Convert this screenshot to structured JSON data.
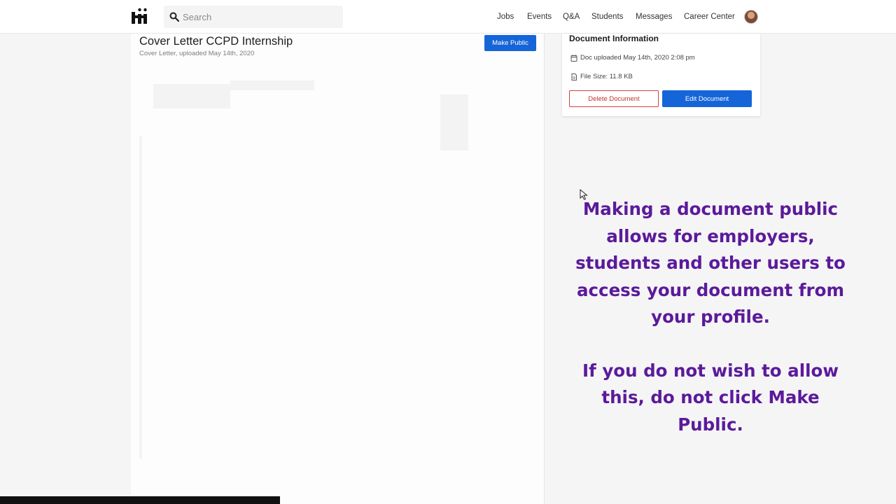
{
  "topbar": {
    "search_placeholder": "Search",
    "nav": [
      "Jobs",
      "Events",
      "Q&A",
      "Students",
      "Messages",
      "Career Center"
    ]
  },
  "document": {
    "title": "Cover Letter CCPD Internship",
    "subtitle": "Cover Letter, uploaded May 14th, 2020",
    "make_public_label": "Make Public"
  },
  "info": {
    "heading": "Document Information",
    "uploaded": "Doc uploaded May 14th, 2020 2:08 pm",
    "file_size": "File Size: 11.8 KB",
    "delete_label": "Delete Document",
    "edit_label": "Edit Document"
  },
  "overlay": {
    "paragraph1": "Making a document public allows for employers, students and other users to access your document from your profile.",
    "paragraph2": "If you do not wish to allow this, do not click Make Public."
  },
  "colors": {
    "primary": "#1565d8",
    "danger": "#c53030",
    "overlay_text": "#5b1a9b"
  }
}
